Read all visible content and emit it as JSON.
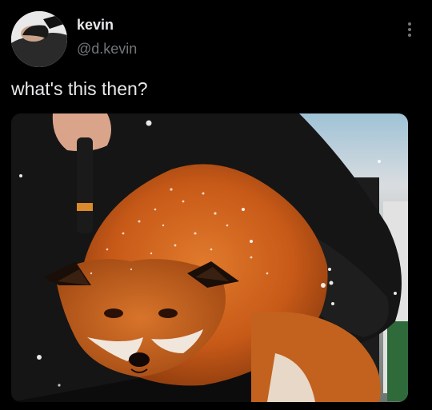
{
  "tweet": {
    "author": {
      "name": "kevin",
      "handle": "@d.kevin",
      "avatar_icon": "profile-photo"
    },
    "text": "what's this then?",
    "more_icon": "more-options-icon",
    "media": {
      "alt_kind": "photo",
      "subject": "fox-with-snow"
    }
  },
  "colors": {
    "background": "#000000",
    "primary_text": "#e7e9ea",
    "secondary_text": "#71767b",
    "fox_orange": "#d4661f"
  }
}
